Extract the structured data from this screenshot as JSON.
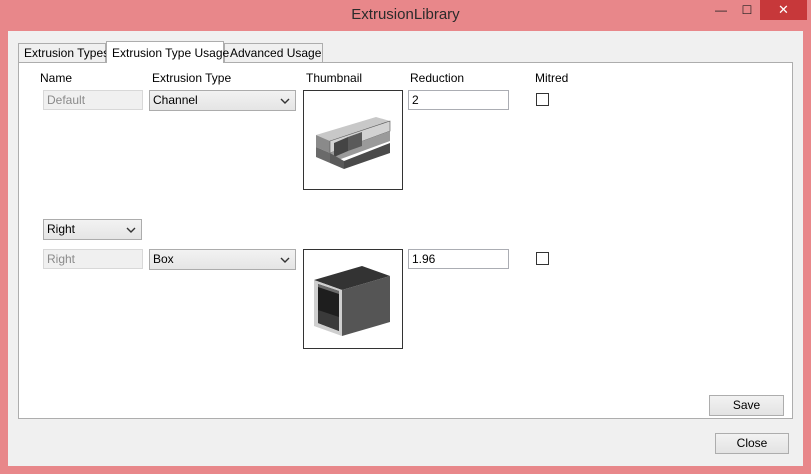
{
  "window": {
    "title": "ExtrusionLibrary",
    "minimize_glyph": "—",
    "maximize_glyph": "☐",
    "close_glyph": "✕"
  },
  "tabs": [
    {
      "label": "Extrusion Types",
      "active": false
    },
    {
      "label": "Extrusion Type Usage",
      "active": true
    },
    {
      "label": "Advanced Usage",
      "active": false
    }
  ],
  "columns": {
    "name": "Name",
    "extrusion_type": "Extrusion Type",
    "thumbnail": "Thumbnail",
    "reduction": "Reduction",
    "mitred": "Mitred"
  },
  "rows": [
    {
      "name": "Default",
      "extrusion_type": "Channel",
      "reduction": "2",
      "mitred": false,
      "thumbnail_icon": "channel-extrusion-icon"
    },
    {
      "selector": "Right",
      "name": "Right",
      "extrusion_type": "Box",
      "reduction": "1.96",
      "mitred": false,
      "thumbnail_icon": "box-extrusion-icon"
    }
  ],
  "buttons": {
    "save": "Save",
    "close": "Close"
  }
}
